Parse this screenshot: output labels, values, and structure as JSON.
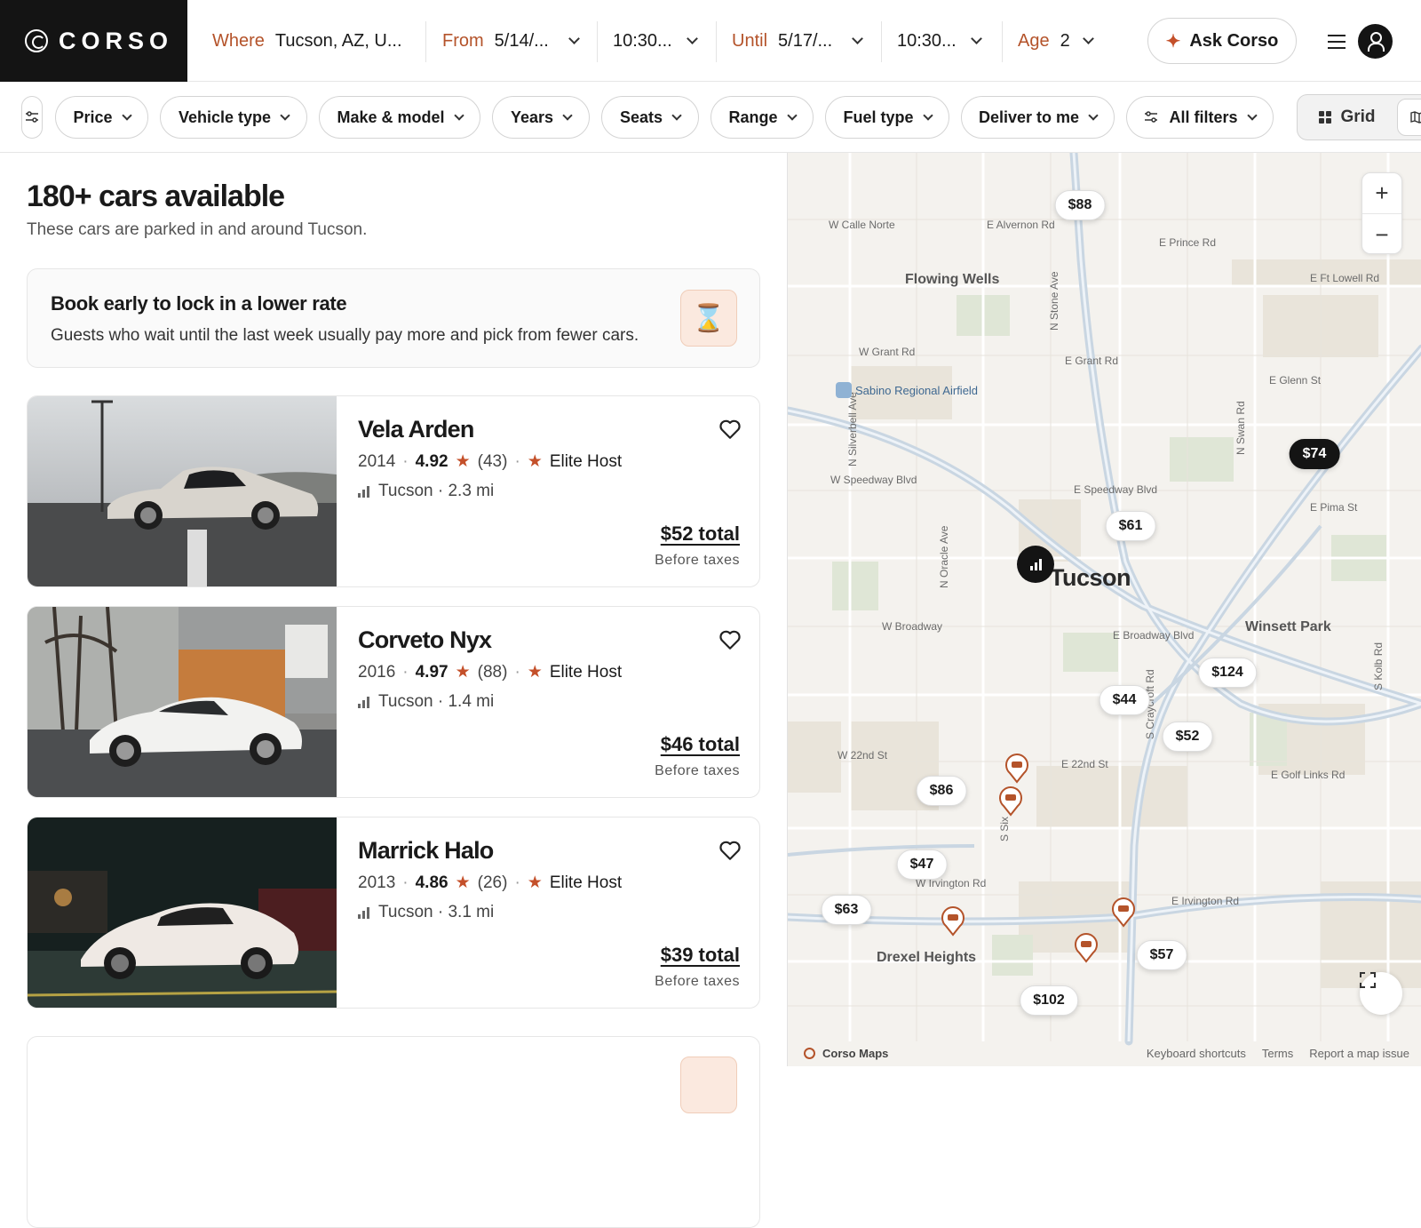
{
  "header": {
    "brand": "CORSO",
    "where_label": "Where",
    "where_value": "Tucson, AZ, U...",
    "from_label": "From",
    "from_date": "5/14/...",
    "from_time": "10:30...",
    "until_label": "Until",
    "until_date": "5/17/...",
    "until_time": "10:30...",
    "age_label": "Age",
    "age_value": "2",
    "ask_label": "Ask Corso"
  },
  "filters": {
    "chips": [
      "Price",
      "Vehicle type",
      "Make & model",
      "Years",
      "Seats",
      "Range",
      "Fuel type",
      "Deliver to me",
      "All filters"
    ],
    "view_grid": "Grid"
  },
  "results": {
    "title": "180+ cars available",
    "subtitle": "These cars are parked in and around Tucson."
  },
  "promo": {
    "title": "Book early to lock in a lower rate",
    "text": "Guests who wait until the last week usually pay more and pick from fewer cars."
  },
  "cars": [
    {
      "name": "Vela Arden",
      "year": "2014",
      "rating": "4.92",
      "reviews": "(43)",
      "host": "Elite Host",
      "location": "Tucson · 2.3 mi",
      "price": "$52 total",
      "taxes": "Before taxes"
    },
    {
      "name": "Corveto Nyx",
      "year": "2016",
      "rating": "4.97",
      "reviews": "(88)",
      "host": "Elite Host",
      "location": "Tucson · 1.4 mi",
      "price": "$46 total",
      "taxes": "Before taxes"
    },
    {
      "name": "Marrick Halo",
      "year": "2013",
      "rating": "4.86",
      "reviews": "(26)",
      "host": "Elite Host",
      "location": "Tucson · 3.1 mi",
      "price": "$39 total",
      "taxes": "Before taxes"
    }
  ],
  "map": {
    "city": "Tucson",
    "areas": {
      "flowing_wells": "Flowing Wells",
      "winsett_park": "Winsett Park",
      "drexel_heights": "Drexel Heights",
      "airfield": "Sabino Regional Airfield"
    },
    "streets": {
      "calle_norte": "W Calle Norte",
      "alvernon": "E Alvernon Rd",
      "prince": "E Prince Rd",
      "ft_lowell": "E Ft Lowell Rd",
      "stone": "N Stone Ave",
      "w_grant": "W Grant Rd",
      "e_grant": "E Grant Rd",
      "glenn": "E Glenn St",
      "silverbell": "N Silverbell Ave",
      "swan": "N Swan Rd",
      "w_speedway": "W Speedway Blvd",
      "e_speedway": "E Speedway Blvd",
      "pima": "E Pima St",
      "oracle": "N Oracle Ave",
      "w_broadway": "W Broadway",
      "e_broadway": "E Broadway Blvd",
      "kolb": "S Kolb Rd",
      "craycroft": "S Craycroft Rd",
      "w_22nd": "W 22nd St",
      "e_22nd": "E 22nd St",
      "golf_links": "E Golf Links Rd",
      "s_six": "S Six",
      "w_irvington": "W Irvington Rd",
      "e_irvington": "E Irvington Rd"
    },
    "prices": [
      "$88",
      "$74",
      "$61",
      "$124",
      "$44",
      "$52",
      "$86",
      "$47",
      "$63",
      "$57",
      "$102"
    ],
    "footer_brand": "Corso Maps",
    "footer_links": [
      "Keyboard shortcuts",
      "Terms",
      "Report a map issue"
    ]
  },
  "colors": {
    "accent": "#b4532a",
    "dark": "#141414"
  }
}
